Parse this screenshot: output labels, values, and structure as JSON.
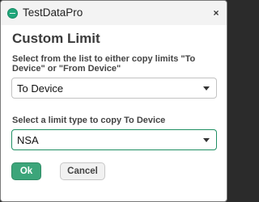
{
  "window": {
    "app_title": "TestDataPro",
    "close_glyph": "×"
  },
  "dialog": {
    "title": "Custom Limit",
    "direction_label": "Select from the list to either copy limits \"To Device\" or \"From Device\"",
    "direction_value": "To Device",
    "limit_type_label": "Select a limit type to copy To Device",
    "limit_type_value": "NSA"
  },
  "buttons": {
    "ok_label": "Ok",
    "cancel_label": "Cancel"
  },
  "icons": {
    "logo": "app-logo-icon",
    "close": "close-icon",
    "dropdown": "chevron-down-icon"
  },
  "colors": {
    "accent": "#3ca57a",
    "focus_border": "#1f8f63"
  }
}
